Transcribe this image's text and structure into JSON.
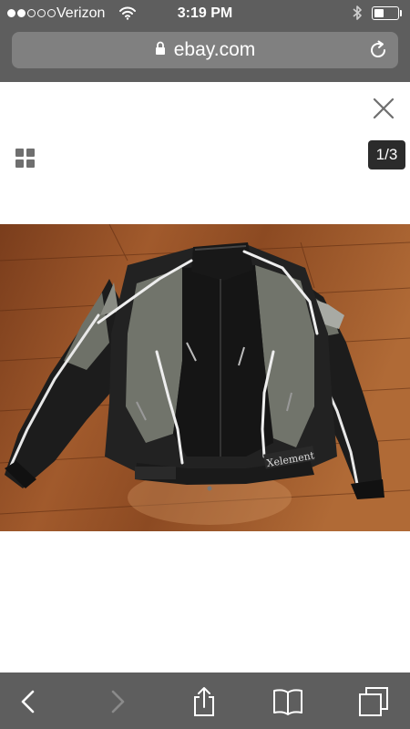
{
  "status_bar": {
    "carrier": "Verizon",
    "time": "3:19 PM",
    "signal_bars_filled": 2,
    "signal_bars_total": 5,
    "battery_level": 0.35
  },
  "address_bar": {
    "domain": "ebay.com",
    "secure": true
  },
  "gallery": {
    "counter": "1/3",
    "image_description": "Black and grey textile motorcycle jacket with reflective piping laid on a wood floor",
    "jacket_label": "Xelement"
  },
  "icons": {
    "close": "close-icon",
    "grid": "grid-view-icon",
    "lock": "lock-icon",
    "reload": "reload-icon",
    "back": "chevron-left-icon",
    "forward": "chevron-right-icon",
    "share": "share-icon",
    "bookmarks": "book-icon",
    "tabs": "tabs-icon"
  },
  "colors": {
    "chrome": "#5e5e5e",
    "url_bar": "#808080",
    "counter_bg": "#2b2b2b",
    "icon_grey": "#6f6f6f"
  }
}
